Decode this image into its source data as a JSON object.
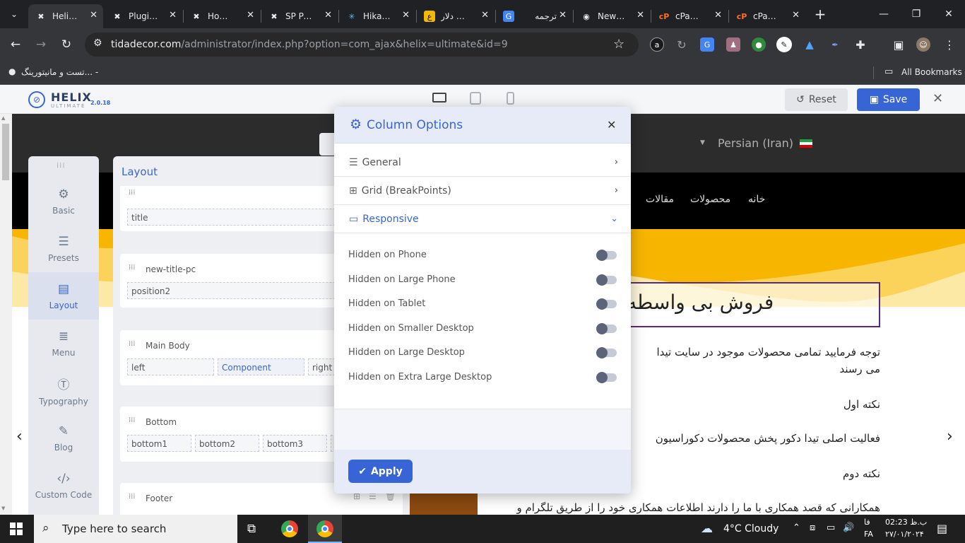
{
  "browser": {
    "tabs": [
      {
        "title": "Helix Ultimate",
        "icon": "joomla-icon",
        "active": true
      },
      {
        "title": "Plugins",
        "icon": "joomla-icon"
      },
      {
        "title": "Home Dashboard",
        "icon": "joomla-icon"
      },
      {
        "title": "SP Page Builder",
        "icon": "joomla-icon"
      },
      {
        "title": "HikaShop",
        "icon": "hikashop-icon"
      },
      {
        "title": "قیمت دلار",
        "icon": "site-icon"
      },
      {
        "title": "ترجمه",
        "icon": "google-translate-icon"
      },
      {
        "title": "New Tab",
        "icon": "chrome-icon"
      },
      {
        "title": "cPanel",
        "icon": "cpanel-icon"
      },
      {
        "title": "cPanel",
        "icon": "cpanel-icon"
      }
    ],
    "url_host": "tidadecor.com",
    "url_path": "/administrator/index.php?option=com_ajax&helix=ultimate&id=9",
    "bookmark_item": "تست و مانیتورینگ... -",
    "all_bookmarks": "All Bookmarks"
  },
  "helix": {
    "logo": "HELIX",
    "logo_sub": "ULTIMATE",
    "version": "2.0.18",
    "reset_label": "Reset",
    "save_label": "Save",
    "sidebar": [
      {
        "label": "Basic",
        "icon": "gear-icon"
      },
      {
        "label": "Presets",
        "icon": "sliders-icon"
      },
      {
        "label": "Layout",
        "icon": "layout-icon",
        "active": true
      },
      {
        "label": "Menu",
        "icon": "menu-icon"
      },
      {
        "label": "Typography",
        "icon": "typography-icon"
      },
      {
        "label": "Blog",
        "icon": "blog-icon"
      },
      {
        "label": "Custom Code",
        "icon": "code-icon"
      }
    ],
    "layout_title": "Layout",
    "rows": [
      {
        "label": "",
        "columns": [
          "title"
        ]
      },
      {
        "label": "new-title-pc",
        "columns": [
          "position2"
        ]
      },
      {
        "label": "Main Body",
        "columns": [
          "left",
          "Component",
          "right"
        ]
      },
      {
        "label": "Bottom",
        "columns": [
          "bottom1",
          "bottom2",
          "bottom3"
        ]
      },
      {
        "label": "Footer",
        "columns": []
      }
    ]
  },
  "site": {
    "language": "Persian (Iran)",
    "nav": [
      "خانه",
      "محصولات",
      "مقالات"
    ],
    "heading": "فروش بی واسطه",
    "para1": "توجه فرمایید تمامی محصولات موجود در سایت تیدا",
    "para1b": "می رسند",
    "note1": "نکته اول",
    "para2": "فعالیت اصلی تیدا دکور پخش محصولات دکوراسیون",
    "note2": "نکته دوم",
    "para3": "همکارانی که قصد همکاری با ما را دارند اطلاعات همکاری خود را از طریق تلگرام و"
  },
  "modal": {
    "title": "Column Options",
    "sections": [
      {
        "label": "General",
        "icon": "sliders-icon",
        "expanded": false
      },
      {
        "label": "Grid (BreakPoints)",
        "icon": "grid-icon",
        "expanded": false
      },
      {
        "label": "Responsive",
        "icon": "laptop-icon",
        "expanded": true
      }
    ],
    "toggles": [
      {
        "label": "Hidden on Phone",
        "on": false
      },
      {
        "label": "Hidden on Large Phone",
        "on": false
      },
      {
        "label": "Hidden on Tablet",
        "on": false
      },
      {
        "label": "Hidden on Smaller Desktop",
        "on": false
      },
      {
        "label": "Hidden on Large Desktop",
        "on": false
      },
      {
        "label": "Hidden on Extra Large Desktop",
        "on": false
      }
    ],
    "apply_label": "Apply"
  },
  "taskbar": {
    "search_placeholder": "Type here to search",
    "weather": "4°C  Cloudy",
    "lang1": "فا",
    "lang2": "FA",
    "time": "02:23 ب.ظ",
    "date": "۲۷/۰۱/۲۰۲۴"
  },
  "colors": {
    "accent": "#3865d6",
    "header_dark": "#2c2c2c",
    "wave": "#f7b500"
  }
}
